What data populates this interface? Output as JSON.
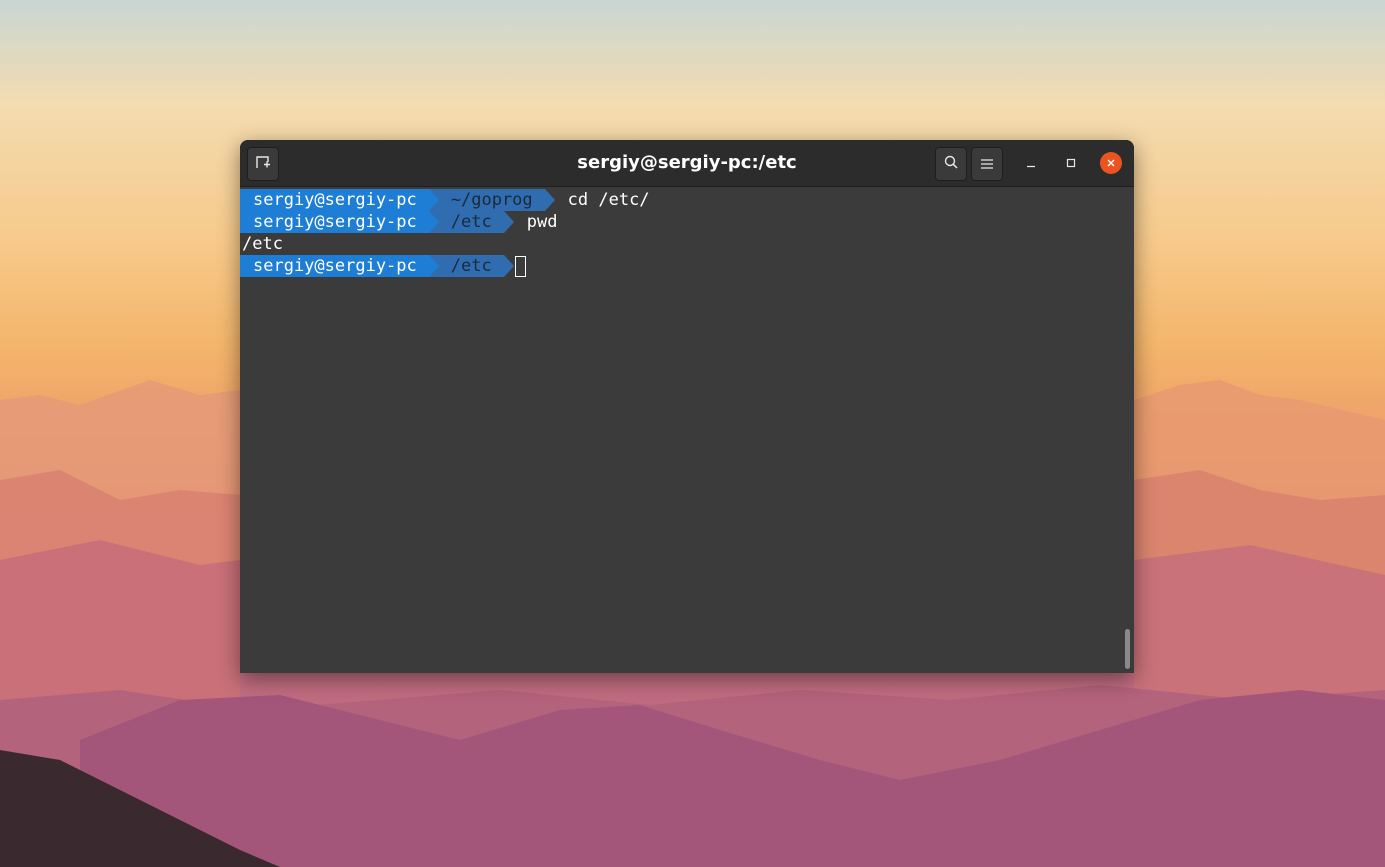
{
  "window": {
    "title": "sergiy@sergiy-pc:/etc",
    "buttons": {
      "new_tab_icon": "new-tab-icon",
      "search_icon": "search-icon",
      "menu_icon": "hamburger-menu-icon",
      "minimize_icon": "minimize-icon",
      "maximize_icon": "maximize-icon",
      "close_icon": "close-icon"
    },
    "close_color": "#e95420"
  },
  "terminal": {
    "lines": [
      {
        "user": "sergiy@sergiy-pc",
        "dir": "~/goprog",
        "command": "cd /etc/"
      },
      {
        "user": "sergiy@sergiy-pc",
        "dir": "/etc",
        "command": "pwd"
      },
      {
        "output": "/etc"
      },
      {
        "user": "sergiy@sergiy-pc",
        "dir": "/etc",
        "command": ""
      }
    ],
    "prompt_user_color": "#1e7ed6",
    "prompt_dir_color": "#2f6db0",
    "background_color": "#3c3b3b"
  }
}
